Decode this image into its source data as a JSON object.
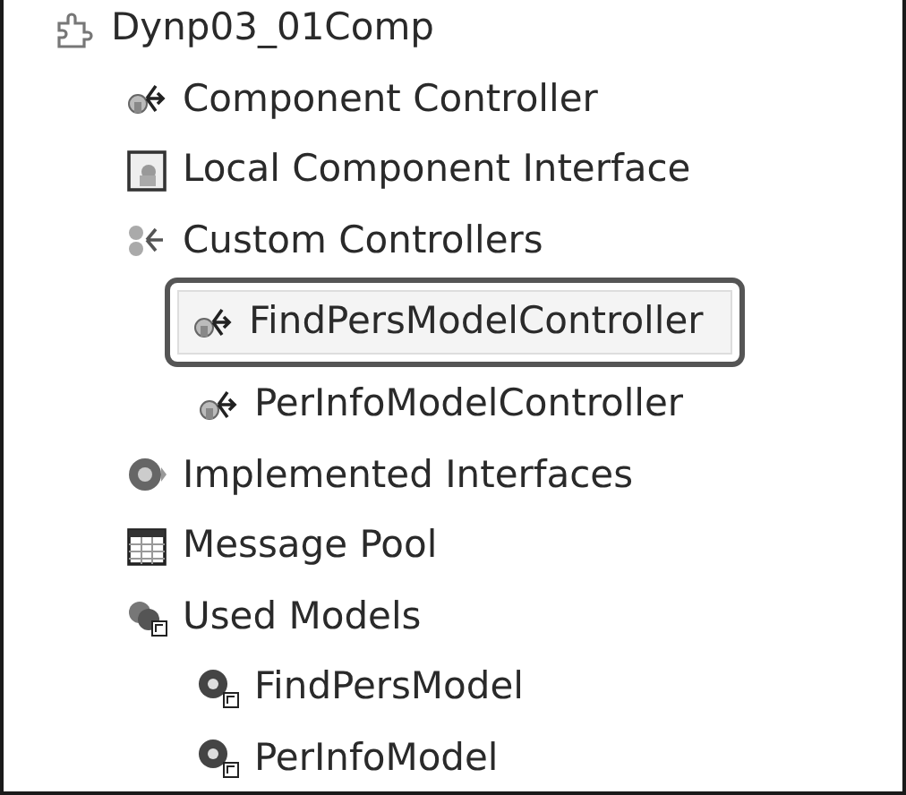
{
  "tree": [
    {
      "label": "Dynp03_01Comp",
      "kind": "component",
      "selected": false,
      "children": [
        {
          "label": "Component Controller",
          "kind": "controller",
          "selected": false
        },
        {
          "label": "Local Component Interface",
          "kind": "interface",
          "selected": false
        },
        {
          "label": "Custom Controllers",
          "kind": "controllers",
          "selected": false,
          "children": [
            {
              "label": "FindPersModelController",
              "kind": "controller",
              "selected": true
            },
            {
              "label": "PerInfoModelController",
              "kind": "controller",
              "selected": false
            }
          ]
        },
        {
          "label": "Implemented Interfaces",
          "kind": "implemented",
          "selected": false
        },
        {
          "label": "Message Pool",
          "kind": "messages",
          "selected": false
        },
        {
          "label": "Used Models",
          "kind": "models",
          "selected": false,
          "children": [
            {
              "label": "FindPersModel",
              "kind": "model",
              "selected": false
            },
            {
              "label": "PerInfoModel",
              "kind": "model",
              "selected": false
            }
          ]
        }
      ]
    }
  ]
}
